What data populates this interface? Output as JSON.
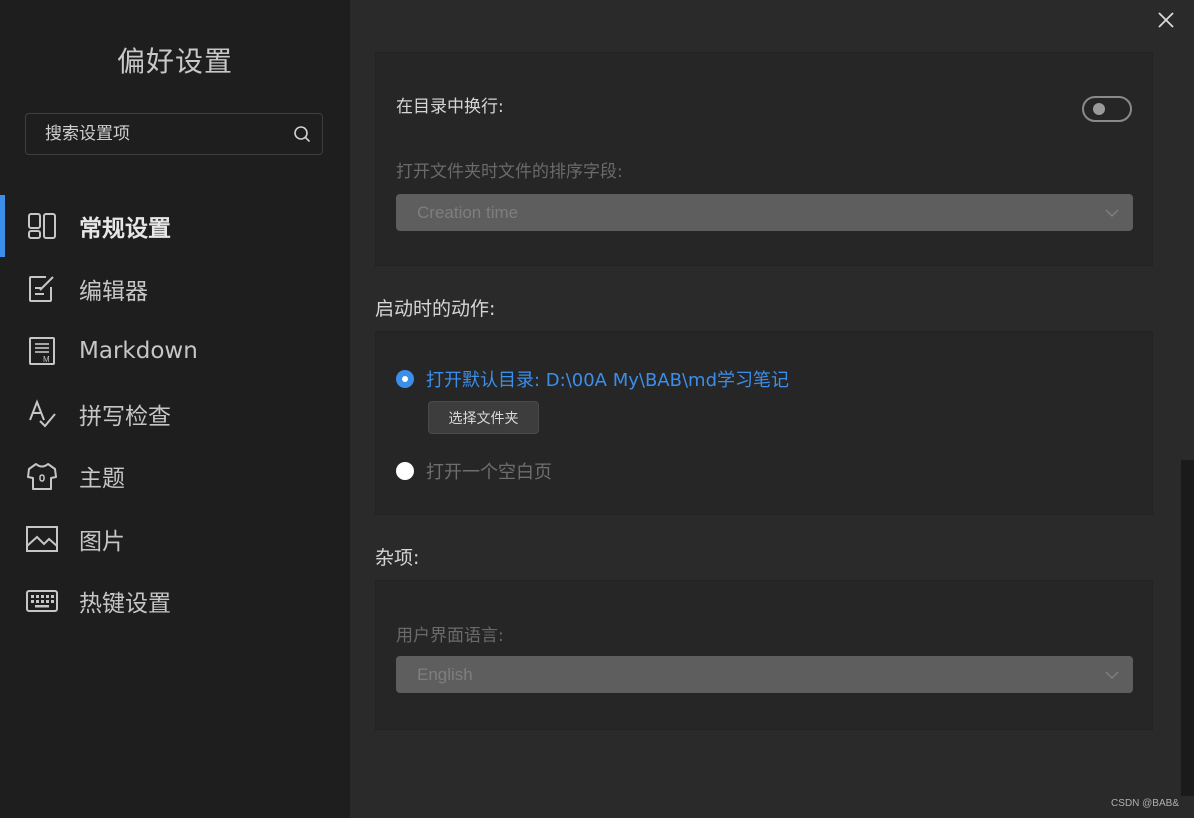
{
  "sidebar": {
    "title": "偏好设置",
    "search_placeholder": "搜索设置项",
    "items": [
      {
        "label": "常规设置",
        "icon": "layout-icon",
        "active": true
      },
      {
        "label": "编辑器",
        "icon": "edit-icon"
      },
      {
        "label": "Markdown",
        "icon": "markdown-icon"
      },
      {
        "label": "拼写检查",
        "icon": "spellcheck-icon"
      },
      {
        "label": "主题",
        "icon": "theme-shirt-icon"
      },
      {
        "label": "图片",
        "icon": "image-icon"
      },
      {
        "label": "热键设置",
        "icon": "keyboard-icon"
      }
    ]
  },
  "main": {
    "card1": {
      "wrap_label": "在目录中换行:",
      "wrap_toggle": "off",
      "sort_label": "打开文件夹时文件的排序字段:",
      "sort_value": "Creation time"
    },
    "startup": {
      "heading": "启动时的动作:",
      "option1": "打开默认目录: D:\\00A My\\BAB\\md学习笔记",
      "choose_folder": "选择文件夹",
      "option2": "打开一个空白页"
    },
    "misc": {
      "heading": "杂项:",
      "language_label": "用户界面语言:",
      "language_value": "English"
    }
  },
  "watermark": "CSDN @BAB&",
  "colors": {
    "accent": "#3b8eea",
    "sidebar_bg": "#1e1e1e",
    "main_bg": "#2a2a2a"
  }
}
